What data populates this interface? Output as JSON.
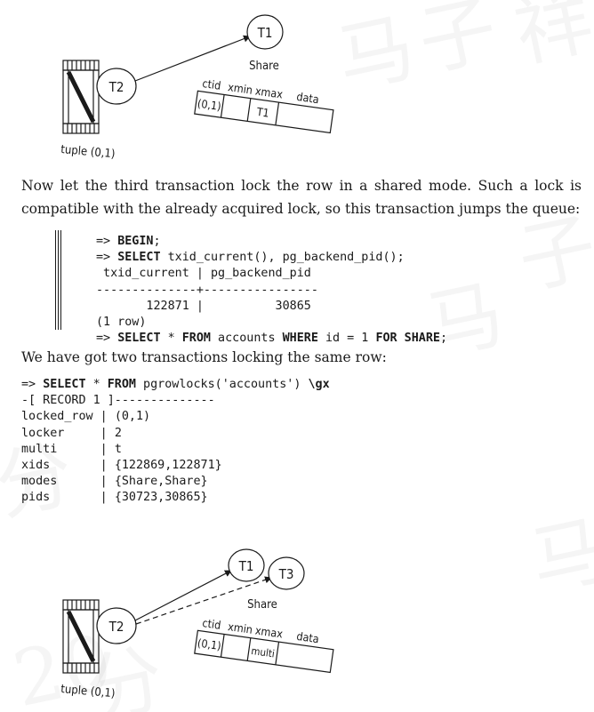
{
  "diagram1": {
    "transaction_top": "T1",
    "transaction_locker": "T2",
    "lock_mode": "Share",
    "columns": [
      "ctid",
      "xmin",
      "xmax",
      "data"
    ],
    "row": {
      "ctid": "(0,1)",
      "xmin": "",
      "xmax": "T1",
      "data": ""
    },
    "tuple_label": "tuple (0,1)"
  },
  "paragraph1": "Now let the third transaction lock the row in a shared mode. Such a lock is compatible with the already acquired lock, so this transaction jumps the queue:",
  "session": {
    "prompt": "=>",
    "line1": {
      "kw": "BEGIN",
      "rest": ";"
    },
    "line2": {
      "kw": "SELECT",
      "rest": " txid_current(), pg_backend_pid();"
    },
    "result_header": " txid_current | pg_backend_pid",
    "result_separator": "--------------+----------------",
    "result_row": "       122871 |          30865",
    "result_count": "(1 row)",
    "line3": {
      "kw1": "SELECT",
      "mid1": " * ",
      "kw2": "FROM",
      "mid2": " accounts ",
      "kw3": "WHERE",
      "mid3": " id = 1 ",
      "kw4": "FOR SHARE",
      "end": ";"
    }
  },
  "paragraph2": "We have got two transactions locking the same row:",
  "query": {
    "prompt": "=>",
    "kw1": "SELECT",
    "mid1": " * ",
    "kw2": "FROM",
    "mid2": " pgrowlocks('accounts') ",
    "kw3": "\\gx",
    "record_header": "-[ RECORD 1 ]--------------",
    "rows": [
      {
        "field": "locked_row",
        "value": "(0,1)"
      },
      {
        "field": "locker    ",
        "value": "2"
      },
      {
        "field": "multi     ",
        "value": "t"
      },
      {
        "field": "xids      ",
        "value": "{122869,122871}"
      },
      {
        "field": "modes     ",
        "value": "{Share,Share}"
      },
      {
        "field": "pids      ",
        "value": "{30723,30865}"
      }
    ]
  },
  "diagram2": {
    "transaction_top": "T1",
    "transaction_third": "T3",
    "transaction_locker": "T2",
    "lock_mode": "Share",
    "columns": [
      "ctid",
      "xmin",
      "xmax",
      "data"
    ],
    "row": {
      "ctid": "(0,1)",
      "xmin": "",
      "xmax": "multi",
      "data": ""
    },
    "tuple_label": "tuple (0,1)"
  },
  "watermark": [
    "马",
    "子",
    "祥",
    "马",
    "子",
    "马",
    "分",
    "20",
    "分"
  ]
}
